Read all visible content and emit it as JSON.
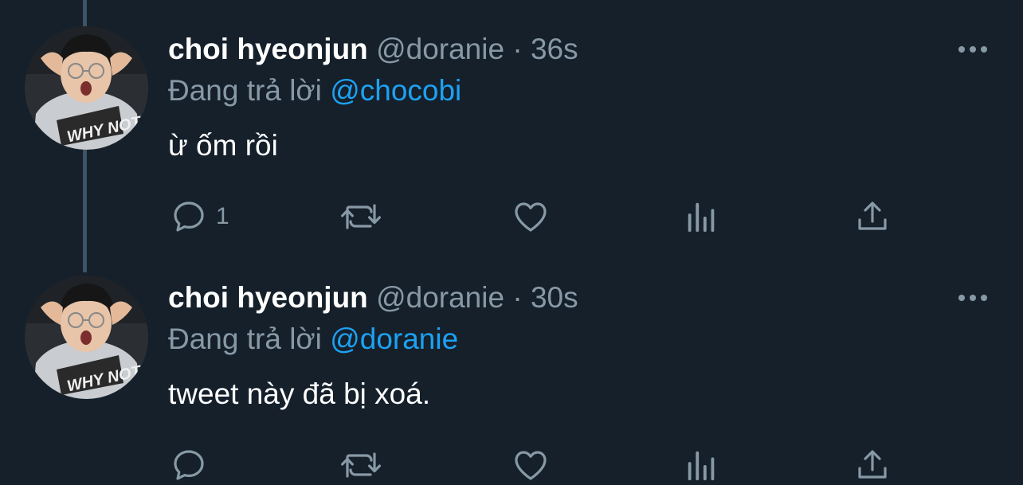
{
  "tweets": [
    {
      "name": "choi hyeonjun",
      "handle": "@doranie",
      "dot": "·",
      "time": "36s",
      "reply_prefix": "Đang trả lời",
      "reply_to": "@chocobi",
      "text": "ừ ốm rồi",
      "reply_count": "1"
    },
    {
      "name": "choi hyeonjun",
      "handle": "@doranie",
      "dot": "·",
      "time": "30s",
      "reply_prefix": "Đang trả lời",
      "reply_to": "@doranie",
      "text": "tweet này đã bị xoá.",
      "reply_count": ""
    }
  ],
  "avatar_text": "WHY NOT?!",
  "icons": {
    "reply": "reply-icon",
    "retweet": "retweet-icon",
    "like": "heart-icon",
    "analytics": "analytics-icon",
    "share": "share-icon",
    "more": "more-icon"
  },
  "colors": {
    "background": "#15202b",
    "text": "#ffffff",
    "muted": "#8899a6",
    "accent": "#1da1f2",
    "thread_line": "#3d5466"
  }
}
